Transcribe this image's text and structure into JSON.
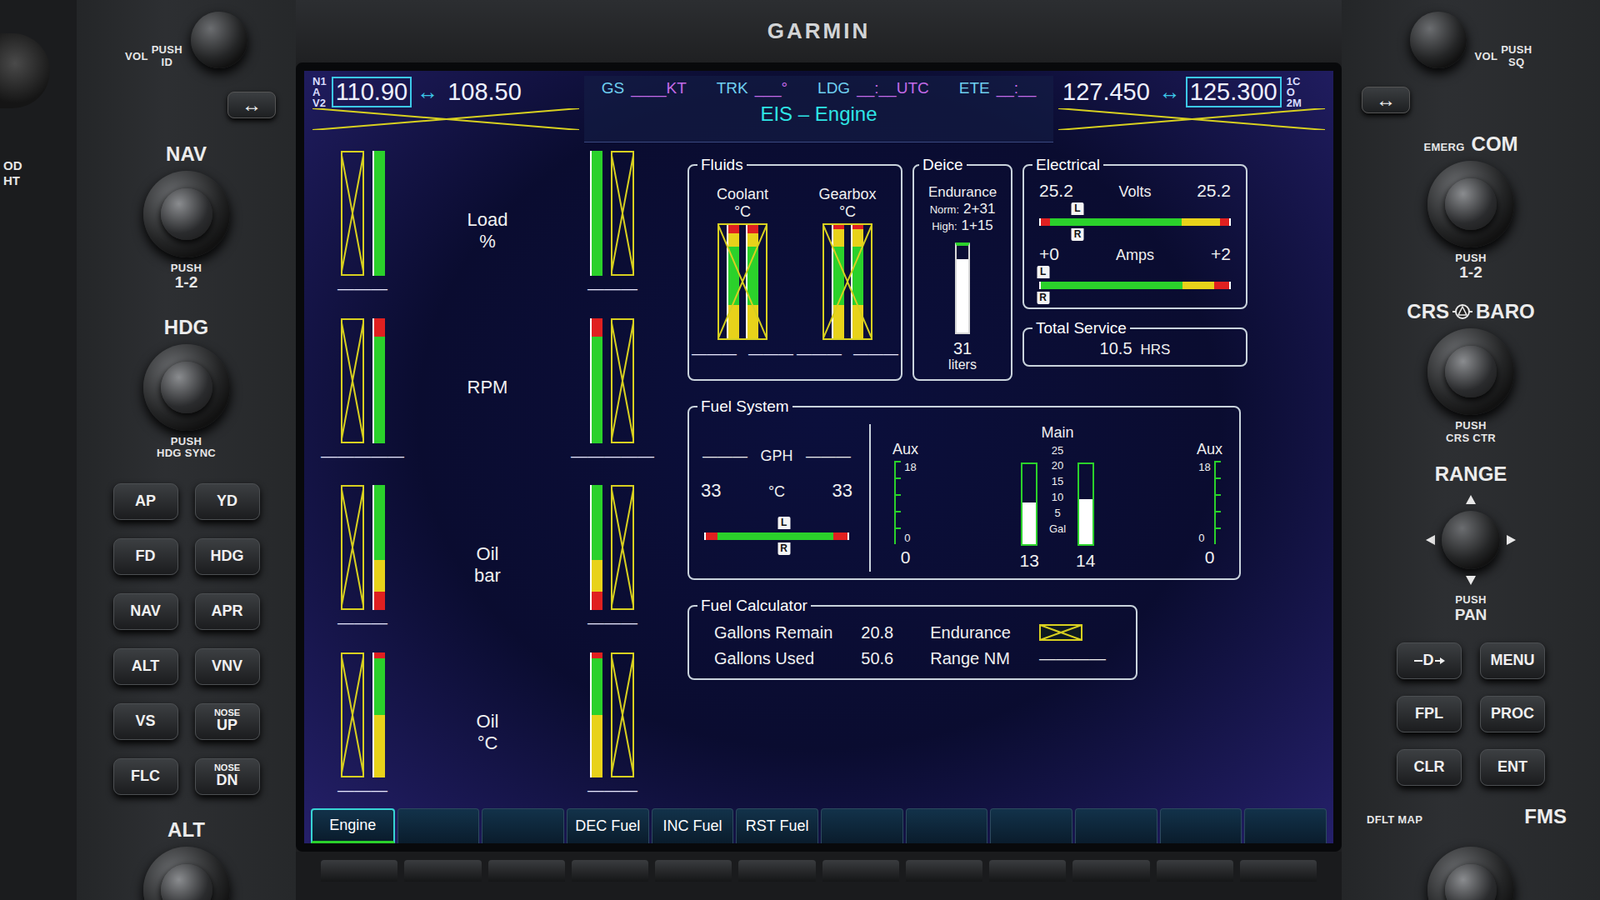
{
  "bezel": {
    "brand": "GARMIN",
    "edge_text": [
      "OD",
      "HT"
    ],
    "left": {
      "vol": {
        "label": "VOL",
        "push": "PUSH",
        "sub": "ID"
      },
      "swap": "↔",
      "nav": {
        "label": "NAV",
        "push": "PUSH",
        "sub": "1-2"
      },
      "hdg": {
        "label": "HDG",
        "push": "PUSH",
        "sub": "HDG SYNC"
      },
      "buttons": [
        {
          "label": "AP"
        },
        {
          "label": "YD"
        },
        {
          "label": "FD"
        },
        {
          "label": "HDG"
        },
        {
          "label": "NAV"
        },
        {
          "label": "APR"
        },
        {
          "label": "ALT"
        },
        {
          "label": "VNV"
        },
        {
          "label": "VS"
        },
        {
          "label": "UP",
          "sub": "NOSE"
        },
        {
          "label": "FLC"
        },
        {
          "label": "DN",
          "sub": "NOSE"
        }
      ],
      "alt": {
        "label": "ALT"
      }
    },
    "right": {
      "vol": {
        "label": "VOL",
        "push": "PUSH",
        "sub": "SQ"
      },
      "swap": "↔",
      "com": {
        "label": "COM",
        "emerg": "EMERG",
        "push": "PUSH",
        "sub": "1-2"
      },
      "crs_baro": {
        "left": "CRS",
        "right": "BARO",
        "push": "PUSH",
        "sub": "CRS CTR"
      },
      "range": {
        "label": "RANGE",
        "push": "PUSH",
        "sub": "PAN"
      },
      "buttons": [
        {
          "label": "D",
          "kind": "direct"
        },
        {
          "label": "MENU",
          "kind": "text"
        },
        {
          "label": "FPL",
          "kind": "text"
        },
        {
          "label": "PROC",
          "kind": "text"
        },
        {
          "label": "CLR",
          "kind": "text"
        },
        {
          "label": "ENT",
          "kind": "text"
        }
      ],
      "dflt_map": "DFLT MAP",
      "fms": {
        "label": "FMS"
      }
    }
  },
  "screen": {
    "nav": {
      "id_lines": [
        "N1",
        "A",
        "V2"
      ],
      "freqs": [
        {
          "value": "110.90",
          "selected": true
        },
        {
          "value": "108.50",
          "selected": false
        }
      ],
      "swap": "↔",
      "invalid": true
    },
    "fields": [
      {
        "label": "GS",
        "value": "____KT"
      },
      {
        "label": "TRK",
        "value": "___°"
      },
      {
        "label": "LDG",
        "value": "__:__UTC"
      },
      {
        "label": "ETE",
        "value": "__:__"
      }
    ],
    "page_title": "EIS – Engine",
    "com": {
      "id_lines": [
        "1C",
        "O",
        "2M"
      ],
      "freqs": [
        {
          "value": "127.450",
          "selected": false
        },
        {
          "value": "125.300",
          "selected": true
        }
      ],
      "swap": "↔",
      "invalid": true
    },
    "engine_gauges": [
      {
        "label": "Load",
        "unit": "%",
        "left": {
          "reading": "———",
          "invalid": true,
          "bands": [
            {
              "color": "#2bd12b",
              "share": 1
            }
          ]
        },
        "right": {
          "reading": "———",
          "invalid": true,
          "bands": [
            {
              "color": "#2bd12b",
              "share": 1
            }
          ]
        }
      },
      {
        "label": "RPM",
        "unit": "",
        "left": {
          "reading": "—————",
          "invalid": true,
          "bands": [
            {
              "color": "#e02020",
              "share": 0.15
            },
            {
              "color": "#2bd12b",
              "share": 0.85
            }
          ]
        },
        "right": {
          "reading": "—————",
          "invalid": true,
          "bands": [
            {
              "color": "#e02020",
              "share": 0.15
            },
            {
              "color": "#2bd12b",
              "share": 0.85
            }
          ]
        }
      },
      {
        "label": "Oil",
        "unit": "bar",
        "left": {
          "reading": "———",
          "invalid": true,
          "bands": [
            {
              "color": "#2bd12b",
              "share": 0.6
            },
            {
              "color": "#e8d21a",
              "share": 0.25
            },
            {
              "color": "#e02020",
              "share": 0.15
            }
          ]
        },
        "right": {
          "reading": "———",
          "invalid": true,
          "bands": [
            {
              "color": "#2bd12b",
              "share": 0.6
            },
            {
              "color": "#e8d21a",
              "share": 0.25
            },
            {
              "color": "#e02020",
              "share": 0.15
            }
          ]
        }
      },
      {
        "label": "Oil",
        "unit": "°C",
        "left": {
          "reading": "———",
          "invalid": true,
          "bands": [
            {
              "color": "#e02020",
              "share": 0.05
            },
            {
              "color": "#2bd12b",
              "share": 0.45
            },
            {
              "color": "#e8d21a",
              "share": 0.5
            }
          ]
        },
        "right": {
          "reading": "———",
          "invalid": true,
          "bands": [
            {
              "color": "#e02020",
              "share": 0.05
            },
            {
              "color": "#2bd12b",
              "share": 0.45
            },
            {
              "color": "#e8d21a",
              "share": 0.5
            }
          ]
        }
      }
    ],
    "fluids": {
      "title": "Fluids",
      "gauges": [
        {
          "label": "Coolant",
          "unit": "°C",
          "invalid": true,
          "bands": [
            {
              "color": "#e02020",
              "share": 0.08
            },
            {
              "color": "#e8d21a",
              "share": 0.12
            },
            {
              "color": "#2bd12b",
              "share": 0.5
            },
            {
              "color": "#e8d21a",
              "share": 0.3
            }
          ],
          "readings": [
            "———",
            "———"
          ]
        },
        {
          "label": "Gearbox",
          "unit": "°C",
          "invalid": true,
          "bands": [
            {
              "color": "#e02020",
              "share": 0.05
            },
            {
              "color": "#e8d21a",
              "share": 0.15
            },
            {
              "color": "#2bd12b",
              "share": 0.5
            },
            {
              "color": "#e8d21a",
              "share": 0.3
            }
          ],
          "readings": [
            "———",
            "———"
          ]
        }
      ]
    },
    "deice": {
      "title": "Deice",
      "label": "Endurance",
      "rows": [
        {
          "label": "Norm:",
          "value": "2+31"
        },
        {
          "label": "High:",
          "value": "1+15"
        }
      ],
      "level": 0.85,
      "value": "31",
      "unit": "liters"
    },
    "electrical": {
      "title": "Electrical",
      "meters": [
        {
          "label": "Volts",
          "left": "25.2",
          "right": "25.2",
          "level": 0.2,
          "markers": [
            "L",
            "R"
          ],
          "bands": [
            {
              "color": "#e02020",
              "share": 0.05
            },
            {
              "color": "#2bd12b",
              "share": 0.7
            },
            {
              "color": "#e8d21a",
              "share": 0.2
            },
            {
              "color": "#e02020",
              "share": 0.05
            }
          ]
        },
        {
          "label": "Amps",
          "left": "+0",
          "right": "+2",
          "level": 0.02,
          "markers": [
            "L",
            "R"
          ],
          "bands": [
            {
              "color": "#2bd12b",
              "share": 0.75
            },
            {
              "color": "#e8d21a",
              "share": 0.17
            },
            {
              "color": "#e02020",
              "share": 0.08
            }
          ]
        }
      ]
    },
    "total_service": {
      "title": "Total Service",
      "value": "10.5",
      "unit": "HRS"
    },
    "fuel_system": {
      "title": "Fuel System",
      "flow": {
        "left": "———",
        "unit": "GPH",
        "right": "———"
      },
      "temp": {
        "left": "33",
        "unit": "°C",
        "right": "33",
        "level": 0.55,
        "markers": [
          "L",
          "R"
        ],
        "bands": [
          {
            "color": "#e02020",
            "share": 0.08
          },
          {
            "color": "#2bd12b",
            "share": 0.82
          },
          {
            "color": "#e02020",
            "share": 0.1
          }
        ]
      },
      "aux": [
        {
          "label": "Aux",
          "top": "18",
          "bottom": "0",
          "value": "0",
          "level": 0
        },
        {
          "label": "Aux",
          "top": "18",
          "bottom": "0",
          "value": "0",
          "level": 0
        }
      ],
      "main": {
        "label": "Main",
        "scale": [
          "25",
          "20",
          "15",
          "10",
          "5"
        ],
        "unit": "Gal",
        "tanks": [
          {
            "value": "13",
            "level": 0.52
          },
          {
            "value": "14",
            "level": 0.56
          }
        ]
      }
    },
    "fuel_calculator": {
      "title": "Fuel Calculator",
      "columns": [
        [
          {
            "label": "Gallons Remain",
            "value": "20.8",
            "invalid": false
          },
          {
            "label": "Gallons Used",
            "value": "50.6",
            "invalid": false
          }
        ],
        [
          {
            "label": "Endurance",
            "invalid": true
          },
          {
            "label": "Range NM",
            "value": "————",
            "invalid": false
          }
        ]
      ]
    },
    "softkeys": [
      {
        "label": "Engine",
        "selected": true
      },
      {
        "label": "",
        "selected": false
      },
      {
        "label": "",
        "selected": false
      },
      {
        "label": "DEC Fuel",
        "selected": false
      },
      {
        "label": "INC Fuel",
        "selected": false
      },
      {
        "label": "RST Fuel",
        "selected": false
      },
      {
        "label": "",
        "selected": false
      },
      {
        "label": "",
        "selected": false
      },
      {
        "label": "",
        "selected": false
      },
      {
        "label": "",
        "selected": false
      },
      {
        "label": "",
        "selected": false
      },
      {
        "label": "",
        "selected": false
      }
    ]
  }
}
